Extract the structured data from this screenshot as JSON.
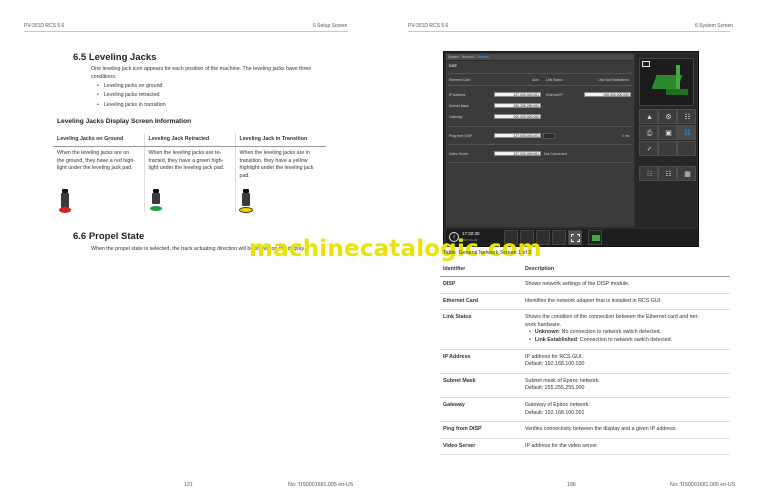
{
  "header": {
    "left_page_doc": "PV-351D RCS 5.6",
    "left_page_chapter": "6 Setup Screen",
    "right_page_doc": "PV-351D RCS 5.6",
    "right_page_chapter": "6 System Screen"
  },
  "section_6_5": {
    "number_title": "6.5  Leveling Jacks",
    "intro_line1": "One leveling jack icon appears for each position of the machine. The leveling jacks have three",
    "intro_line2": "conditions:",
    "bullets": [
      "Leveling jacks on ground",
      "Leveling jacks retracted",
      "Leveling jacks in transition"
    ],
    "subtitle": "Leveling Jacks Display Screen Information",
    "table": {
      "headers": [
        "Leveling Jacks on Ground",
        "Leveling Jack Retracted",
        "Leveling Jack in Transition"
      ],
      "rows": [
        [
          "When the leveling jacks are on",
          "When the leveling jacks are re-",
          "When the leveling jacks are in"
        ],
        [
          "the ground, they have a red high-",
          "tracted, they have a green high-",
          "transition, they have a yellow"
        ],
        [
          "light under the leveling jack pad.",
          "light under the leveling jack pad.",
          "highlight under the leveling jack"
        ],
        [
          "",
          "",
          "pad."
        ]
      ]
    },
    "jack_colors": {
      "ground": "#d4232b",
      "retracted": "#1e9e3a",
      "transition": "#f2d400"
    }
  },
  "section_6_6": {
    "number_title": "6.6  Propel State",
    "text": "When the propel state is selected, the track actuating direction will be shown on the display."
  },
  "screenshot": {
    "tab_bar_prefix": "System - Network - ",
    "tab_bar_active": "General",
    "module": "DISP",
    "ethernet_card_label": "Ethernet Card",
    "ethernet_card_value": "Auto",
    "link_status_label": "Link Status",
    "link_status_value": "Link Not Established",
    "ip_address_label": "IP Address",
    "ip_address_value": "127.000.000.001",
    "external_ip_label": "External IP",
    "external_ip_value": "000.000.000.000",
    "subnet_mask_label": "Subnet Mask",
    "subnet_mask_value": "255.255.255.000",
    "gateway_label": "Gateway",
    "gateway_value": "000.000.000.000",
    "ping_label": "Ping from DISP",
    "ping_value": "127.000.000.001",
    "ping_result": "0 ms",
    "video_label": "Video Server",
    "video_value": "127.000.000.001",
    "video_status": "Not Connected",
    "clock_time": "17:32:30",
    "clock_date": "2017-01-30",
    "side_icons": [
      "image-icon",
      "rig-3d-icon",
      "jack-icon",
      "settings-network-icon",
      "printer-icon",
      "lock-icon",
      "network-icon",
      "wrench-icon",
      "tree-network-icon",
      "network-sub-icon",
      "network-grid-icon"
    ],
    "accent_color": "#4aa3ff"
  },
  "caption": "Table: General Network Screen 1 of 2",
  "id_table": {
    "headers": [
      "Identifier",
      "Description"
    ],
    "rows": [
      {
        "id": "DISP",
        "desc": "Shows network settings of the DISP module."
      },
      {
        "id": "Ethernet Card",
        "desc": "Identifies the network adapter that is installed in RCS GUI."
      },
      {
        "id": "Link Status",
        "desc": "Shows the condition of the connection between the Ethernet card and net-",
        "desc2": "work hardware.",
        "sub": [
          {
            "b": "Unknown",
            "t": ": No connection to network switch detected."
          },
          {
            "b": "Link Established",
            "t": ": Connection to network switch detected."
          }
        ]
      },
      {
        "id": "IP Address",
        "desc": "IP address for RCS GUI.",
        "default": "Default: 192.168.100.030"
      },
      {
        "id": "Subnet Mask",
        "desc": "Subnet mask of Epiroc network.",
        "default": "Default: 255.255.255.000"
      },
      {
        "id": "Gateway",
        "desc": "Gateway of Epiroc network.",
        "default": "Default: 192.168.100.001"
      },
      {
        "id": "Ping from DISP",
        "desc": "Verifies connectivity between the display and a given IP address."
      },
      {
        "id": "Video Server",
        "desc": "IP address for the video server."
      }
    ]
  },
  "footer": {
    "left_page_number": "121",
    "left_doc_no": "No: TIS0001681.005 en-US",
    "right_page_number": "186",
    "right_doc_no": "No: TIS0001681.005 en-US"
  },
  "watermark": "machinecatalogic.com"
}
